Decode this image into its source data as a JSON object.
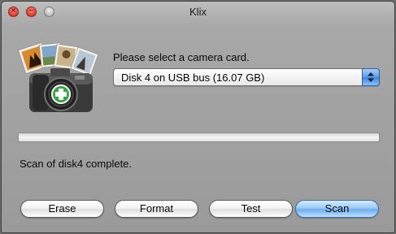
{
  "window": {
    "title": "Klix"
  },
  "header": {
    "prompt": "Please select a camera card."
  },
  "card_select": {
    "selected": "Disk 4 on USB bus (16.07 GB)"
  },
  "progress": {
    "fraction": 0.0
  },
  "status": {
    "text": "Scan of disk4 complete."
  },
  "buttons": {
    "erase": "Erase",
    "format": "Format",
    "test": "Test",
    "scan": "Scan"
  },
  "icons": {
    "app": "camera-with-photos-icon",
    "select_arrows": "up-down-arrows-icon"
  },
  "colors": {
    "default_button": "#6eaef0",
    "close": "#e8473c",
    "badge": "#35a545"
  }
}
